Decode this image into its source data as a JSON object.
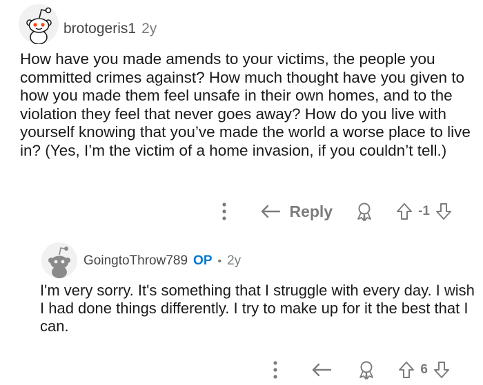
{
  "comments": [
    {
      "username": "brotogeris1",
      "age": "2y",
      "is_op": false,
      "body": "How have you made amends to your victims, the people you committed crimes against? How much thought have you given to how you made them feel unsafe in their own homes, and to the violation they feel that never goes away? How do you live with yourself knowing that you’ve made the world a worse place to live in? (Yes, I’m the victim of a home invasion, if you couldn’t tell.)",
      "actions": {
        "reply_label": "Reply",
        "score": "-1"
      },
      "avatar_icon": "snoo-avatar-icon"
    },
    {
      "username": "GoingtoThrow789",
      "op_badge": "OP",
      "separator": "•",
      "age": "2y",
      "is_op": true,
      "body": "I'm very sorry. It's something that I struggle with every day. I wish I had done things differently. I try to make up for it the best that I can.",
      "actions": {
        "reply_label": "",
        "score": "6"
      },
      "avatar_icon": "snoo-avatar-icon"
    }
  ],
  "colors": {
    "op_blue": "#0079d3",
    "meta_gray": "#787c7e",
    "icon_gray": "#7c7c7c",
    "snoo_orange": "#ff4500"
  }
}
